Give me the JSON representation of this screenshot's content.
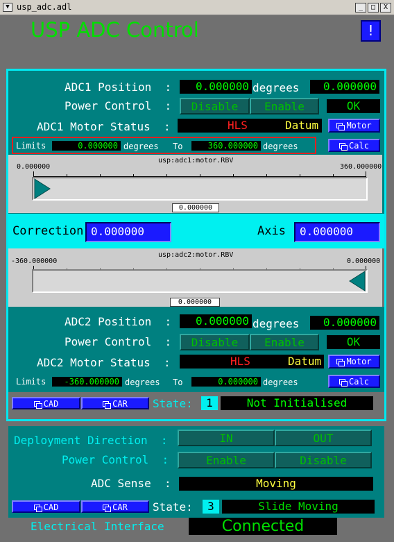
{
  "window": {
    "title": "usp_adc.adl",
    "min_btn": "_",
    "max_btn": "□",
    "close_btn": "X"
  },
  "header": {
    "title": "USP ADC Control",
    "help_btn": "!"
  },
  "adc1": {
    "position_label": "ADC1 Position  :",
    "position_value": "0.000000",
    "position_units": "degrees",
    "position_value2": "0.000000",
    "power_label": "Power Control  :",
    "power_disable": "Disable",
    "power_enable": "Enable",
    "power_status": "OK",
    "motor_status_label": "ADC1 Motor Status  :",
    "motor_status_hls": "HLS",
    "motor_status_datum": "Datum",
    "motor_btn": "Motor",
    "limits_label": "Limits",
    "limit_low": "0.000000",
    "limit_units1": "degrees",
    "limit_to": "To",
    "limit_high": "360.000000",
    "limit_units2": "degrees",
    "calc_btn": "Calc",
    "slider": {
      "pv": "usp:adc1:motor.RBV",
      "min_label": "0.000000",
      "max_label": "360.000000",
      "readout": "0.000000",
      "value": 0,
      "min": 0,
      "max": 360
    }
  },
  "correction": {
    "label": "Correction",
    "value": "0.000000",
    "axis_label": "Axis",
    "axis_value": "0.000000"
  },
  "adc2": {
    "slider": {
      "pv": "usp:adc2:motor.RBV",
      "min_label": "-360.000000",
      "max_label": "0.000000",
      "readout": "0.000000",
      "value": 0,
      "min": -360,
      "max": 0
    },
    "position_label": "ADC2 Position  :",
    "position_value": "0.000000",
    "position_units": "degrees",
    "position_value2": "0.000000",
    "power_label": "Power Control  :",
    "power_disable": "Disable",
    "power_enable": "Enable",
    "power_status": "OK",
    "motor_status_label": "ADC2 Motor Status  :",
    "motor_status_hls": "HLS",
    "motor_status_datum": "Datum",
    "motor_btn": "Motor",
    "limits_label": "Limits",
    "limit_low": "-360.000000",
    "limit_units1": "degrees",
    "limit_to": "To",
    "limit_high": "0.000000",
    "limit_units2": "degrees",
    "calc_btn": "Calc"
  },
  "adc_state": {
    "cad_btn": "CAD",
    "car_btn": "CAR",
    "state_label": "State:",
    "state_num": "1",
    "state_text": "Not Initialised"
  },
  "deploy": {
    "direction_label": "Deployment Direction  :",
    "in_btn": "IN",
    "out_btn": "OUT",
    "power_label": "Power Control  :",
    "enable_btn": "Enable",
    "disable_btn": "Disable",
    "sense_label": "ADC Sense  :",
    "sense_value": "Moving",
    "cad_btn": "CAD",
    "car_btn": "CAR",
    "state_label": "State:",
    "state_num": "3",
    "state_text": "Slide Moving",
    "elec_label": "Electrical Interface",
    "elec_value": "Connected"
  },
  "colors": {
    "panel": "#008080",
    "cyan_border": "#00f0f0",
    "green_text": "#00ff00",
    "red_text": "#ff2020",
    "yellow_text": "#ffff40",
    "blue_btn": "#1a1aff"
  }
}
